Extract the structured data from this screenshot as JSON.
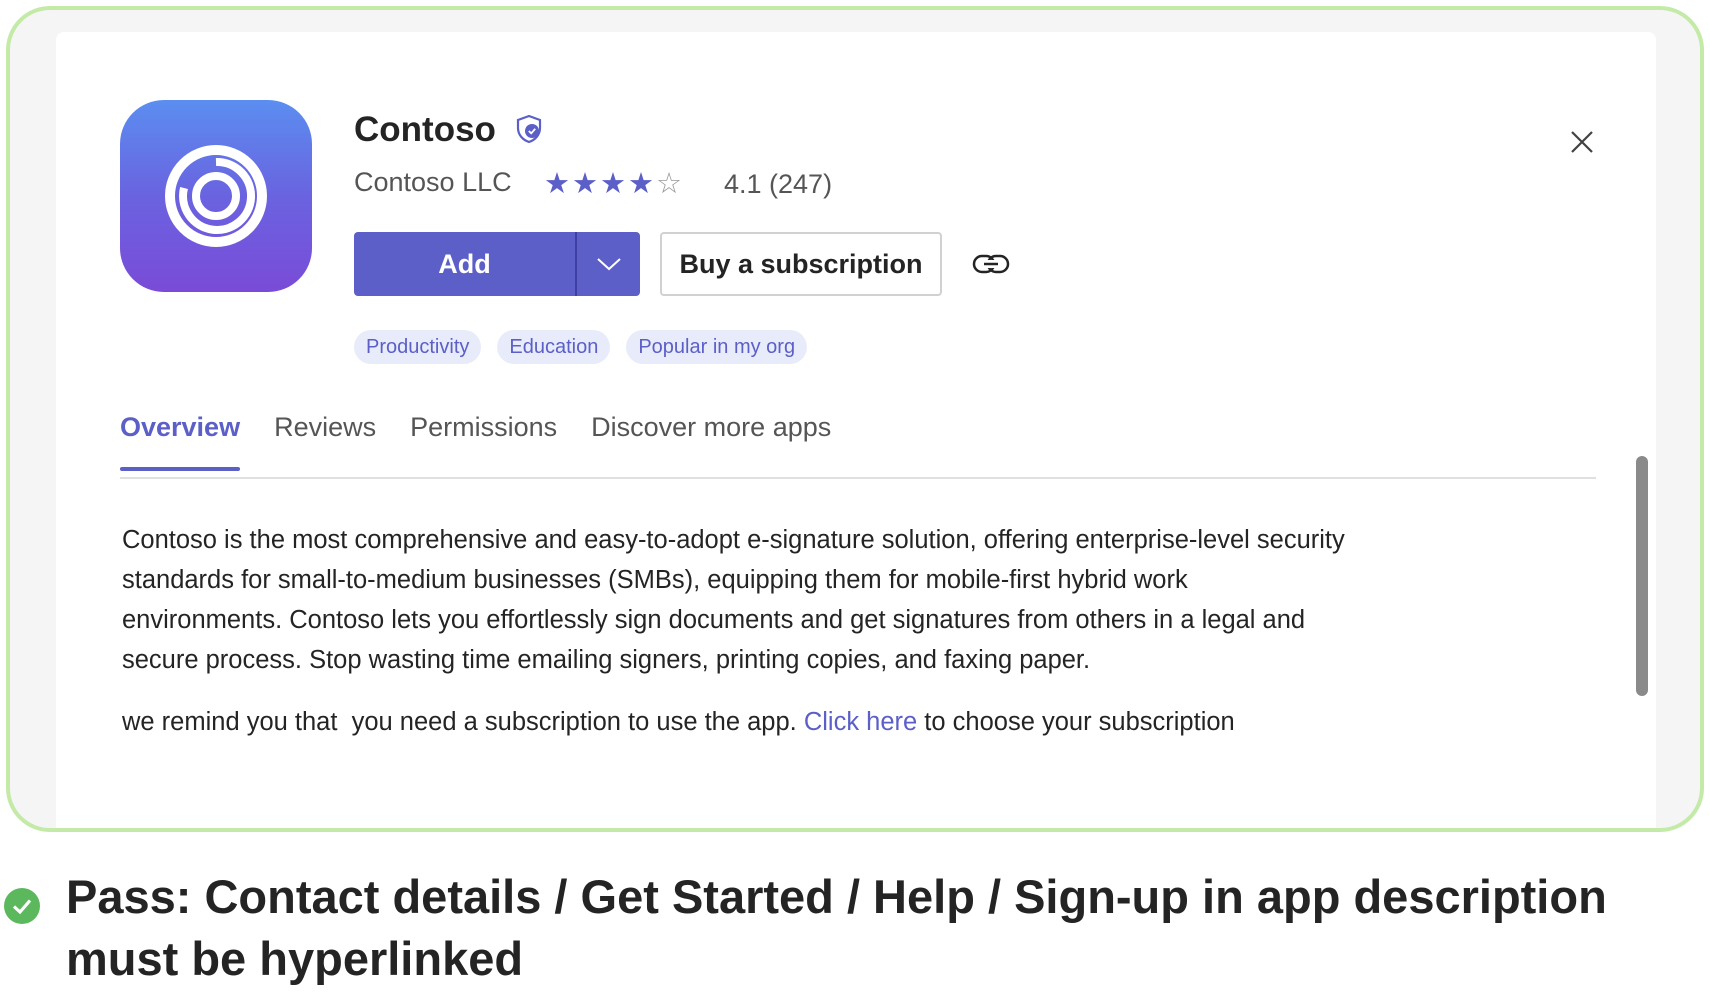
{
  "app": {
    "name": "Contoso",
    "publisher": "Contoso LLC",
    "rating_value": 4.1,
    "rating_text": "4.1 (247)",
    "stars_full": 4,
    "stars_total": 5
  },
  "actions": {
    "add_label": "Add",
    "buy_label": "Buy a subscription"
  },
  "tags": [
    "Productivity",
    "Education",
    "Popular in my org"
  ],
  "tabs": [
    {
      "label": "Overview",
      "active": true
    },
    {
      "label": "Reviews",
      "active": false
    },
    {
      "label": "Permissions",
      "active": false
    },
    {
      "label": "Discover more apps",
      "active": false
    }
  ],
  "description": {
    "line1": "Contoso is the most comprehensive and easy-to-adopt e-signature solution, offering enterprise-level security",
    "line2": "standards for small-to-medium businesses (SMBs), equipping them for mobile-first hybrid work",
    "line3": "environments. Contoso lets you effortlessly sign documents and get signatures from others in a legal and",
    "line4": "secure process. Stop wasting time emailing signers, printing copies, and faxing paper.",
    "reminder_before": "we remind you that  you need a subscription to use the app. ",
    "reminder_link": "Click here",
    "reminder_after": " to choose your subscription"
  },
  "caption": {
    "line1": "Pass: Contact details / Get Started / Help / Sign-up in app description",
    "line2": "must be hyperlinked"
  },
  "colors": {
    "accent": "#5b5fc7",
    "frame_border": "#c4eaa8",
    "pass_green": "#5cb85c"
  },
  "icons": {
    "app_logo": "contoso-ring-logo",
    "verified": "verified-shield-icon",
    "dropdown": "chevron-down-icon",
    "link": "link-icon",
    "close": "close-icon",
    "pass": "check-circle-icon"
  }
}
